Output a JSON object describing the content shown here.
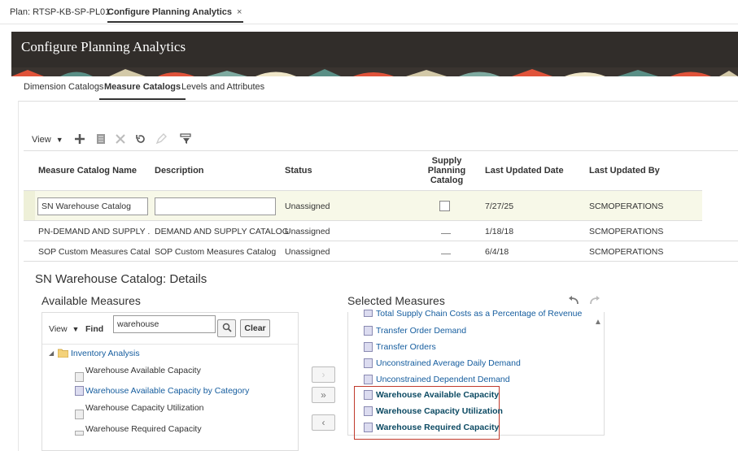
{
  "top_tabs": [
    {
      "label": "Plan: RTSP-KB-SP-PL01"
    },
    {
      "label": "Configure Planning Analytics",
      "close": "×"
    }
  ],
  "header": {
    "title": "Configure Planning Analytics"
  },
  "sub_tabs": [
    {
      "label": "Dimension Catalogs"
    },
    {
      "label": "Measure Catalogs"
    },
    {
      "label": "Levels and Attributes"
    }
  ],
  "toolbar": {
    "view_label": "View",
    "icons": [
      "add-icon",
      "duplicate-icon",
      "delete-icon",
      "refresh-icon",
      "edit-icon",
      "filter-icon"
    ]
  },
  "table": {
    "columns": [
      "Measure Catalog Name",
      "Description",
      "Status",
      "Supply Planning Catalog",
      "Last Updated Date",
      "Last Updated By"
    ],
    "rows": [
      {
        "name": "SN Warehouse Catalog",
        "description": "",
        "status": "Unassigned",
        "supply": "checkbox",
        "date": "7/27/25",
        "by": "SCMOPERATIONS"
      },
      {
        "name": "PN-DEMAND AND SUPPLY ...",
        "description": "DEMAND AND SUPPLY CATALOG",
        "status": "Unassigned",
        "supply": "dash",
        "date": "1/18/18",
        "by": "SCMOPERATIONS"
      },
      {
        "name": "SOP Custom Measures Catal...",
        "description": "SOP Custom Measures Catalog",
        "status": "Unassigned",
        "supply": "dash",
        "date": "6/4/18",
        "by": "SCMOPERATIONS"
      }
    ]
  },
  "details": {
    "title": "SN Warehouse Catalog: Details",
    "available": {
      "title": "Available Measures",
      "view_label": "View",
      "find_label": "Find",
      "search_value": "warehouse",
      "clear_label": "Clear",
      "folder": "Inventory Analysis",
      "items": [
        "Warehouse Available Capacity",
        "Warehouse Available Capacity by Category",
        "Warehouse Capacity Utilization",
        "Warehouse Required Capacity"
      ]
    },
    "move_buttons": {
      "move": "›",
      "move_all": "»",
      "remove": "‹"
    },
    "selected": {
      "title": "Selected Measures",
      "items": [
        "Total Supply Chain Costs as a Percentage of Revenue",
        "Transfer Order Demand",
        "Transfer Orders",
        "Unconstrained Average Daily Demand",
        "Unconstrained Dependent Demand"
      ],
      "highlighted_items": [
        "Warehouse Available Capacity",
        "Warehouse Capacity Utilization",
        "Warehouse Required Capacity"
      ]
    }
  },
  "colors": {
    "banner": "#312d2a",
    "link": "#145c9e",
    "highlight_border": "#c0392b",
    "selected_row": "#f7f8e8"
  }
}
